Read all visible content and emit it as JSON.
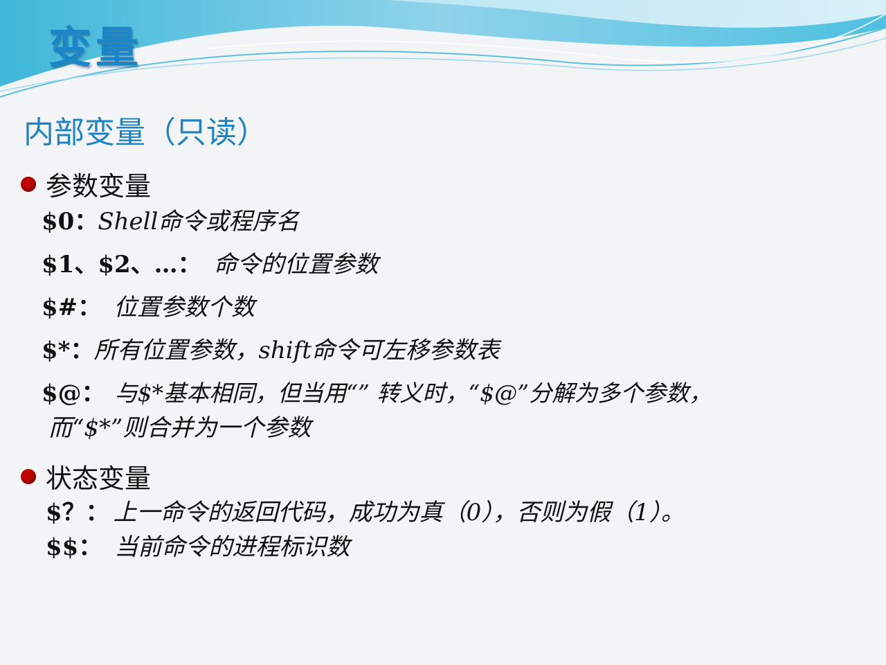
{
  "title": "变量",
  "subtitle": "内部变量（只读）",
  "sections": [
    {
      "heading": "参数变量",
      "items": [
        {
          "key": "$0：",
          "desc": "Shell命令或程序名"
        },
        {
          "key": "$1、$2、…：",
          "desc": "命令的位置参数"
        },
        {
          "key": "$#：",
          "desc": "位置参数个数"
        },
        {
          "key": "$*：",
          "desc": "所有位置参数，shift命令可左移参数表"
        },
        {
          "key": "$@：",
          "desc": "与$*基本相同，但当用“” 转义时，“$@”分解为多个参数，",
          "cont": "而“$*”则合并为一个参数"
        }
      ]
    },
    {
      "heading": "状态变量",
      "items": [
        {
          "key": "$？：",
          "desc": "上一命令的返回代码，成功为真（0），否则为假（1）。"
        },
        {
          "key": "$$：",
          "desc": "当前命令的进程标识数"
        }
      ]
    }
  ],
  "colors": {
    "title": "#1a86c8",
    "subtitle": "#1d83c2",
    "bullet": "#c00000"
  }
}
